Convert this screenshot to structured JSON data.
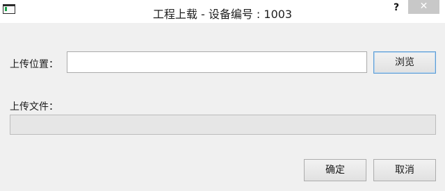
{
  "window": {
    "title": "工程上载 - 设备编号 : 1003",
    "help_label": "?",
    "close_label": "✕"
  },
  "form": {
    "location_label": "上传位置：",
    "location_value": "",
    "browse_label": "浏览",
    "file_label": "上传文件：",
    "progress_fraction": 0
  },
  "footer": {
    "ok_label": "确定",
    "cancel_label": "取消"
  },
  "colors": {
    "titlebar": "#ffffff",
    "window_bg": "#f0f0f0",
    "close_button": "#c8c8c8",
    "browse_focus_border": "#5a9bd5"
  },
  "icons": {
    "app": "app-window-icon",
    "help": "question-mark-icon",
    "close": "close-icon"
  }
}
